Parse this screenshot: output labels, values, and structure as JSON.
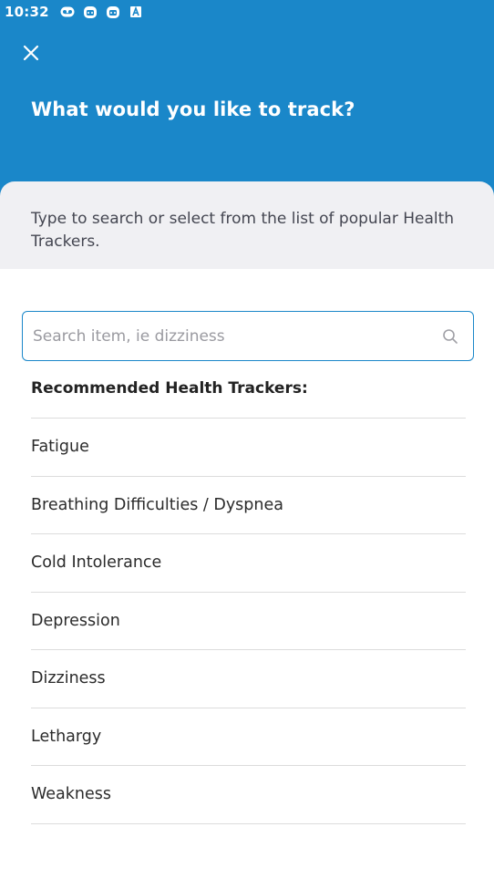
{
  "status_bar": {
    "time": "10:32",
    "icons": [
      "voicemail-icon",
      "robot-icon",
      "robot-icon",
      "text-a-icon"
    ]
  },
  "header": {
    "close_icon": "close-icon",
    "title": "What would you like to track?",
    "background_color": "#1a87c9"
  },
  "info": {
    "text": "Type to search or select from the list of popular Health Trackers."
  },
  "search": {
    "placeholder": "Search item, ie dizziness",
    "value": "",
    "icon": "search-icon",
    "border_color": "#1a87c9"
  },
  "list": {
    "heading": "Recommended Health Trackers:",
    "items": [
      {
        "label": "Fatigue"
      },
      {
        "label": "Breathing Difficulties / Dyspnea"
      },
      {
        "label": "Cold Intolerance"
      },
      {
        "label": "Depression"
      },
      {
        "label": "Dizziness"
      },
      {
        "label": "Lethargy"
      },
      {
        "label": "Weakness"
      }
    ]
  }
}
